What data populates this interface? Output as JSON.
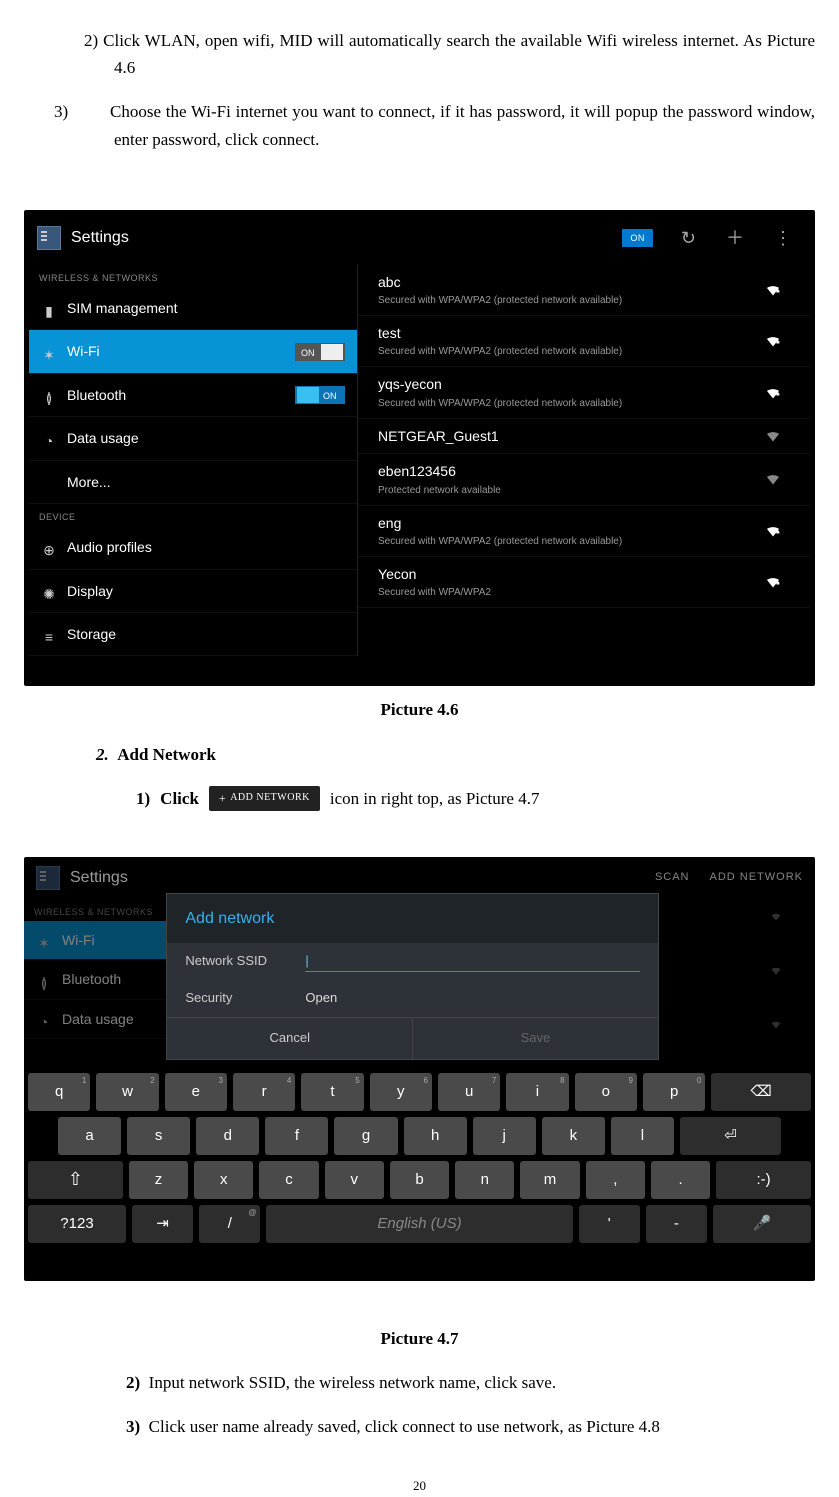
{
  "doc": {
    "step2": "2) Click WLAN, open wifi, MID will automatically search the available Wifi wireless internet. As Picture 4.6",
    "step3_num": "3)",
    "step3": "Choose the Wi-Fi internet you want to connect, if it has password, it will popup the password window, enter password, click connect.",
    "caption1": "Picture 4.6",
    "sec2_num": "2.",
    "sec2_title": "Add Network",
    "sub1_num": "1)",
    "sub1_a": "Click",
    "sub1_btn": "ADD NETWORK",
    "sub1_b": "icon in right top, as Picture 4.7",
    "caption2": "Picture 4.7",
    "sub2_num": "2)",
    "sub2": "Input network SSID, the wireless network name, click save.",
    "sub3_num": "3)",
    "sub3": "Click user name already saved, click connect to use network, as Picture 4.8",
    "page_num": "20"
  },
  "s1": {
    "title": "Settings",
    "on": "ON",
    "wireless_hdr": "WIRELESS & NETWORKS",
    "device_hdr": "DEVICE",
    "sim": "SIM management",
    "wifi": "Wi-Fi",
    "bt": "Bluetooth",
    "data": "Data usage",
    "more": "More...",
    "audio": "Audio profiles",
    "display": "Display",
    "storage": "Storage",
    "nets": [
      {
        "name": "abc",
        "sub": "Secured with WPA/WPA2 (protected network available)",
        "lock": true,
        "strong": true
      },
      {
        "name": "test",
        "sub": "Secured with WPA/WPA2 (protected network available)",
        "lock": true,
        "strong": true
      },
      {
        "name": "yqs-yecon",
        "sub": "Secured with WPA/WPA2 (protected network available)",
        "lock": true,
        "strong": true
      },
      {
        "name": "NETGEAR_Guest1",
        "sub": "",
        "lock": false,
        "strong": false
      },
      {
        "name": "eben123456",
        "sub": "Protected network available",
        "lock": false,
        "strong": false
      },
      {
        "name": "eng",
        "sub": "Secured with WPA/WPA2 (protected network available)",
        "lock": true,
        "strong": true
      },
      {
        "name": "Yecon",
        "sub": "Secured with WPA/WPA2",
        "lock": true,
        "strong": true
      }
    ]
  },
  "s2": {
    "title": "Settings",
    "scan": "SCAN",
    "addnet": "ADD NETWORK",
    "wireless_hdr": "WIRELESS & NETWORKS",
    "wifi": "Wi-Fi",
    "bt": "Bluetooth",
    "data": "Data usage",
    "dlg_title": "Add network",
    "ssid_label": "Network SSID",
    "sec_label": "Security",
    "sec_val": "Open",
    "cancel": "Cancel",
    "save": "Save",
    "kb_space": "English (US)",
    "kb_mode": "?123"
  }
}
